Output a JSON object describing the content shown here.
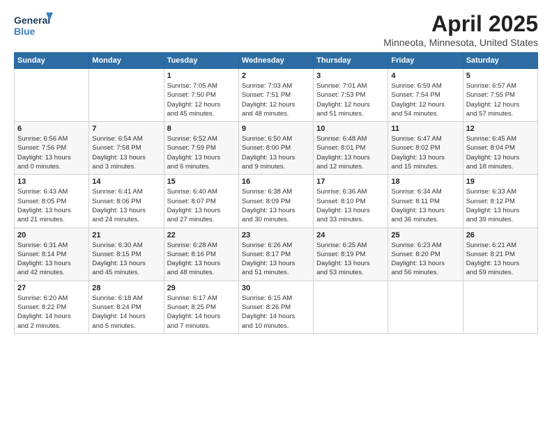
{
  "header": {
    "logo_line1": "General",
    "logo_line2": "Blue",
    "title": "April 2025",
    "subtitle": "Minneota, Minnesota, United States"
  },
  "days_of_week": [
    "Sunday",
    "Monday",
    "Tuesday",
    "Wednesday",
    "Thursday",
    "Friday",
    "Saturday"
  ],
  "weeks": [
    [
      {
        "day": "",
        "info": ""
      },
      {
        "day": "",
        "info": ""
      },
      {
        "day": "1",
        "info": "Sunrise: 7:05 AM\nSunset: 7:50 PM\nDaylight: 12 hours\nand 45 minutes."
      },
      {
        "day": "2",
        "info": "Sunrise: 7:03 AM\nSunset: 7:51 PM\nDaylight: 12 hours\nand 48 minutes."
      },
      {
        "day": "3",
        "info": "Sunrise: 7:01 AM\nSunset: 7:53 PM\nDaylight: 12 hours\nand 51 minutes."
      },
      {
        "day": "4",
        "info": "Sunrise: 6:59 AM\nSunset: 7:54 PM\nDaylight: 12 hours\nand 54 minutes."
      },
      {
        "day": "5",
        "info": "Sunrise: 6:57 AM\nSunset: 7:55 PM\nDaylight: 12 hours\nand 57 minutes."
      }
    ],
    [
      {
        "day": "6",
        "info": "Sunrise: 6:56 AM\nSunset: 7:56 PM\nDaylight: 13 hours\nand 0 minutes."
      },
      {
        "day": "7",
        "info": "Sunrise: 6:54 AM\nSunset: 7:58 PM\nDaylight: 13 hours\nand 3 minutes."
      },
      {
        "day": "8",
        "info": "Sunrise: 6:52 AM\nSunset: 7:59 PM\nDaylight: 13 hours\nand 6 minutes."
      },
      {
        "day": "9",
        "info": "Sunrise: 6:50 AM\nSunset: 8:00 PM\nDaylight: 13 hours\nand 9 minutes."
      },
      {
        "day": "10",
        "info": "Sunrise: 6:48 AM\nSunset: 8:01 PM\nDaylight: 13 hours\nand 12 minutes."
      },
      {
        "day": "11",
        "info": "Sunrise: 6:47 AM\nSunset: 8:02 PM\nDaylight: 13 hours\nand 15 minutes."
      },
      {
        "day": "12",
        "info": "Sunrise: 6:45 AM\nSunset: 8:04 PM\nDaylight: 13 hours\nand 18 minutes."
      }
    ],
    [
      {
        "day": "13",
        "info": "Sunrise: 6:43 AM\nSunset: 8:05 PM\nDaylight: 13 hours\nand 21 minutes."
      },
      {
        "day": "14",
        "info": "Sunrise: 6:41 AM\nSunset: 8:06 PM\nDaylight: 13 hours\nand 24 minutes."
      },
      {
        "day": "15",
        "info": "Sunrise: 6:40 AM\nSunset: 8:07 PM\nDaylight: 13 hours\nand 27 minutes."
      },
      {
        "day": "16",
        "info": "Sunrise: 6:38 AM\nSunset: 8:09 PM\nDaylight: 13 hours\nand 30 minutes."
      },
      {
        "day": "17",
        "info": "Sunrise: 6:36 AM\nSunset: 8:10 PM\nDaylight: 13 hours\nand 33 minutes."
      },
      {
        "day": "18",
        "info": "Sunrise: 6:34 AM\nSunset: 8:11 PM\nDaylight: 13 hours\nand 36 minutes."
      },
      {
        "day": "19",
        "info": "Sunrise: 6:33 AM\nSunset: 8:12 PM\nDaylight: 13 hours\nand 39 minutes."
      }
    ],
    [
      {
        "day": "20",
        "info": "Sunrise: 6:31 AM\nSunset: 8:14 PM\nDaylight: 13 hours\nand 42 minutes."
      },
      {
        "day": "21",
        "info": "Sunrise: 6:30 AM\nSunset: 8:15 PM\nDaylight: 13 hours\nand 45 minutes."
      },
      {
        "day": "22",
        "info": "Sunrise: 6:28 AM\nSunset: 8:16 PM\nDaylight: 13 hours\nand 48 minutes."
      },
      {
        "day": "23",
        "info": "Sunrise: 6:26 AM\nSunset: 8:17 PM\nDaylight: 13 hours\nand 51 minutes."
      },
      {
        "day": "24",
        "info": "Sunrise: 6:25 AM\nSunset: 8:19 PM\nDaylight: 13 hours\nand 53 minutes."
      },
      {
        "day": "25",
        "info": "Sunrise: 6:23 AM\nSunset: 8:20 PM\nDaylight: 13 hours\nand 56 minutes."
      },
      {
        "day": "26",
        "info": "Sunrise: 6:21 AM\nSunset: 8:21 PM\nDaylight: 13 hours\nand 59 minutes."
      }
    ],
    [
      {
        "day": "27",
        "info": "Sunrise: 6:20 AM\nSunset: 8:22 PM\nDaylight: 14 hours\nand 2 minutes."
      },
      {
        "day": "28",
        "info": "Sunrise: 6:18 AM\nSunset: 8:24 PM\nDaylight: 14 hours\nand 5 minutes."
      },
      {
        "day": "29",
        "info": "Sunrise: 6:17 AM\nSunset: 8:25 PM\nDaylight: 14 hours\nand 7 minutes."
      },
      {
        "day": "30",
        "info": "Sunrise: 6:15 AM\nSunset: 8:26 PM\nDaylight: 14 hours\nand 10 minutes."
      },
      {
        "day": "",
        "info": ""
      },
      {
        "day": "",
        "info": ""
      },
      {
        "day": "",
        "info": ""
      }
    ]
  ]
}
